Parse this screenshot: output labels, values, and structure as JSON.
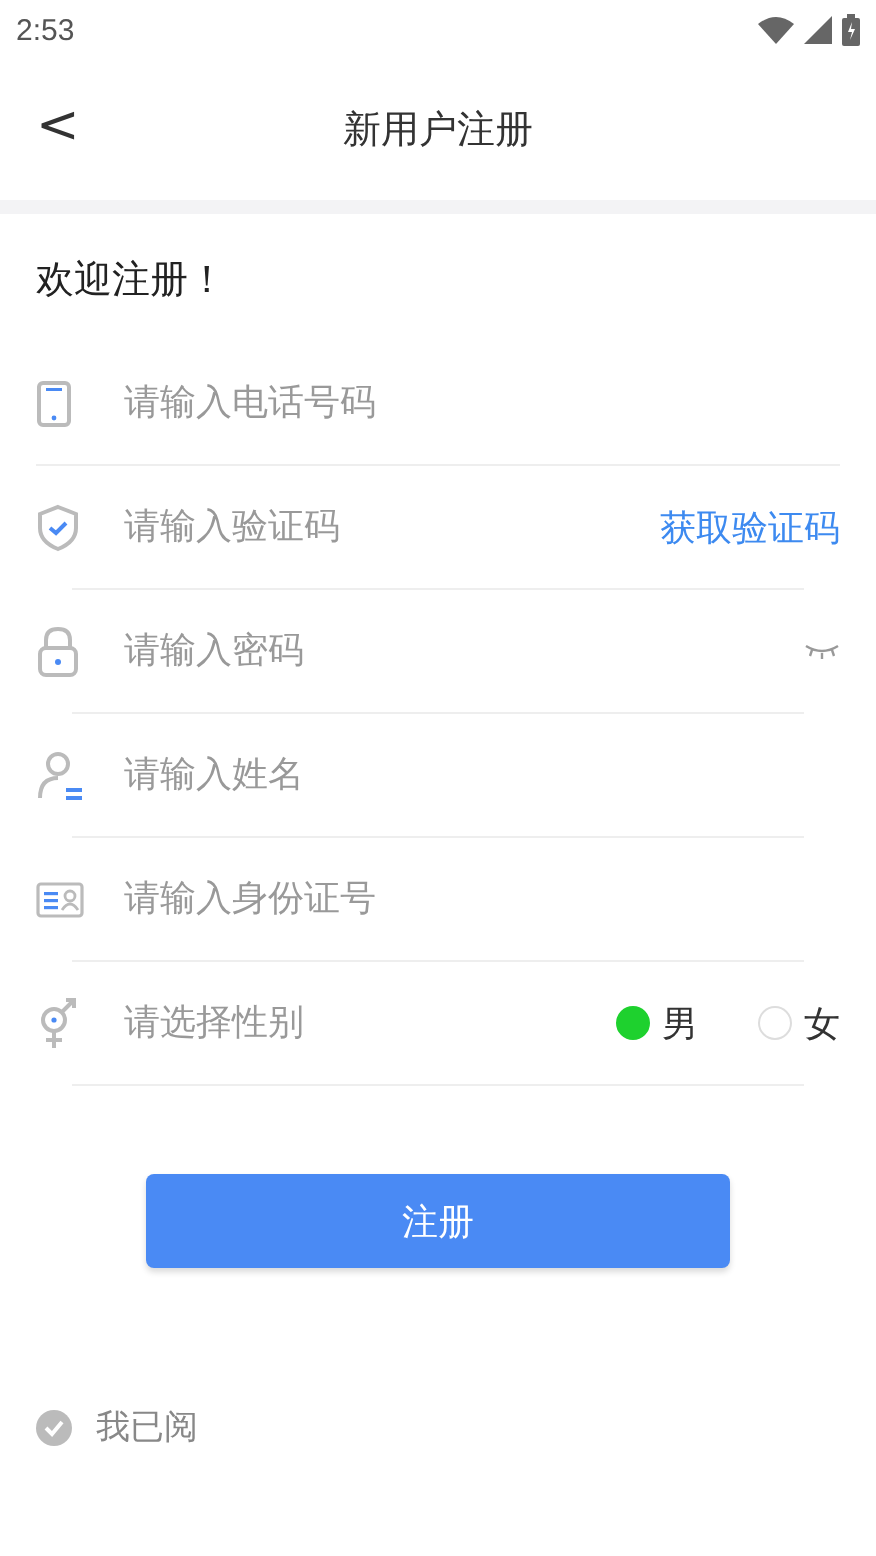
{
  "status_bar": {
    "time": "2:53"
  },
  "header": {
    "back": "<",
    "title": "新用户注册"
  },
  "welcome": "欢迎注册！",
  "fields": [
    {
      "kind": "phone",
      "placeholder": "请输入电话号码"
    },
    {
      "kind": "code",
      "placeholder": "请输入验证码",
      "action": "获取验证码"
    },
    {
      "kind": "password",
      "placeholder": "请输入密码"
    },
    {
      "kind": "name",
      "placeholder": "请输入姓名"
    },
    {
      "kind": "id",
      "placeholder": "请输入身份证号"
    },
    {
      "kind": "gender",
      "placeholder": "请选择性别",
      "options": [
        {
          "label": "男",
          "selected": true
        },
        {
          "label": "女",
          "selected": false
        }
      ]
    }
  ],
  "submit": "注册",
  "agreement": {
    "checked": false,
    "text": "我已阅"
  }
}
